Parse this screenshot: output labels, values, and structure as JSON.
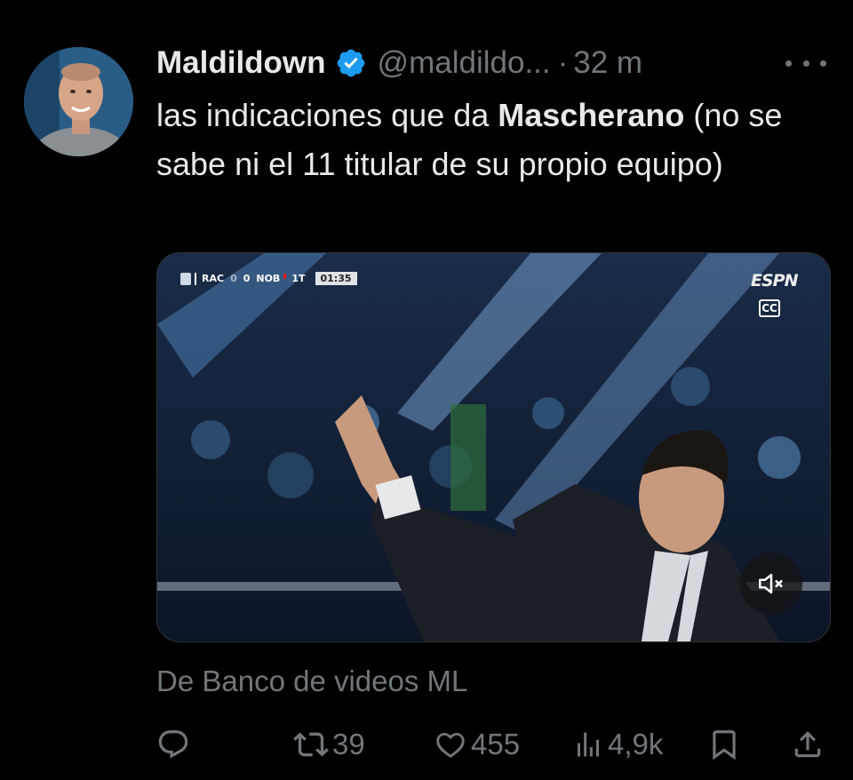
{
  "tweet": {
    "author_name": "Maldildown",
    "handle": "@maldildo...",
    "separator": "·",
    "time": "32 m",
    "text_before": "las indicaciones que da ",
    "text_bold": "Mascherano",
    "text_after": " (no se sabe ni el 11 titular de su propio equipo)",
    "source": "De Banco de videos ML"
  },
  "video": {
    "scorebug": {
      "home": "RAC",
      "home_score": "0",
      "away_score": "0",
      "away": "NOB",
      "half": "1T",
      "clock": "01:35"
    },
    "broadcaster_logo": "ESPN",
    "cc_label": "CC"
  },
  "actions": {
    "reply_count": "",
    "retweet_count": "39",
    "like_count": "455",
    "views_count": "4,9k"
  },
  "icons": {
    "verified": "verified-badge-icon",
    "more": "more-dots-icon",
    "reply": "reply-icon",
    "retweet": "retweet-icon",
    "like": "heart-icon",
    "views": "views-chart-icon",
    "bookmark": "bookmark-icon",
    "share": "share-icon",
    "mute": "muted-speaker-icon"
  },
  "colors": {
    "background": "#000000",
    "text": "#e7e9ea",
    "muted": "#71767b",
    "verified": "#1d9bf0"
  }
}
